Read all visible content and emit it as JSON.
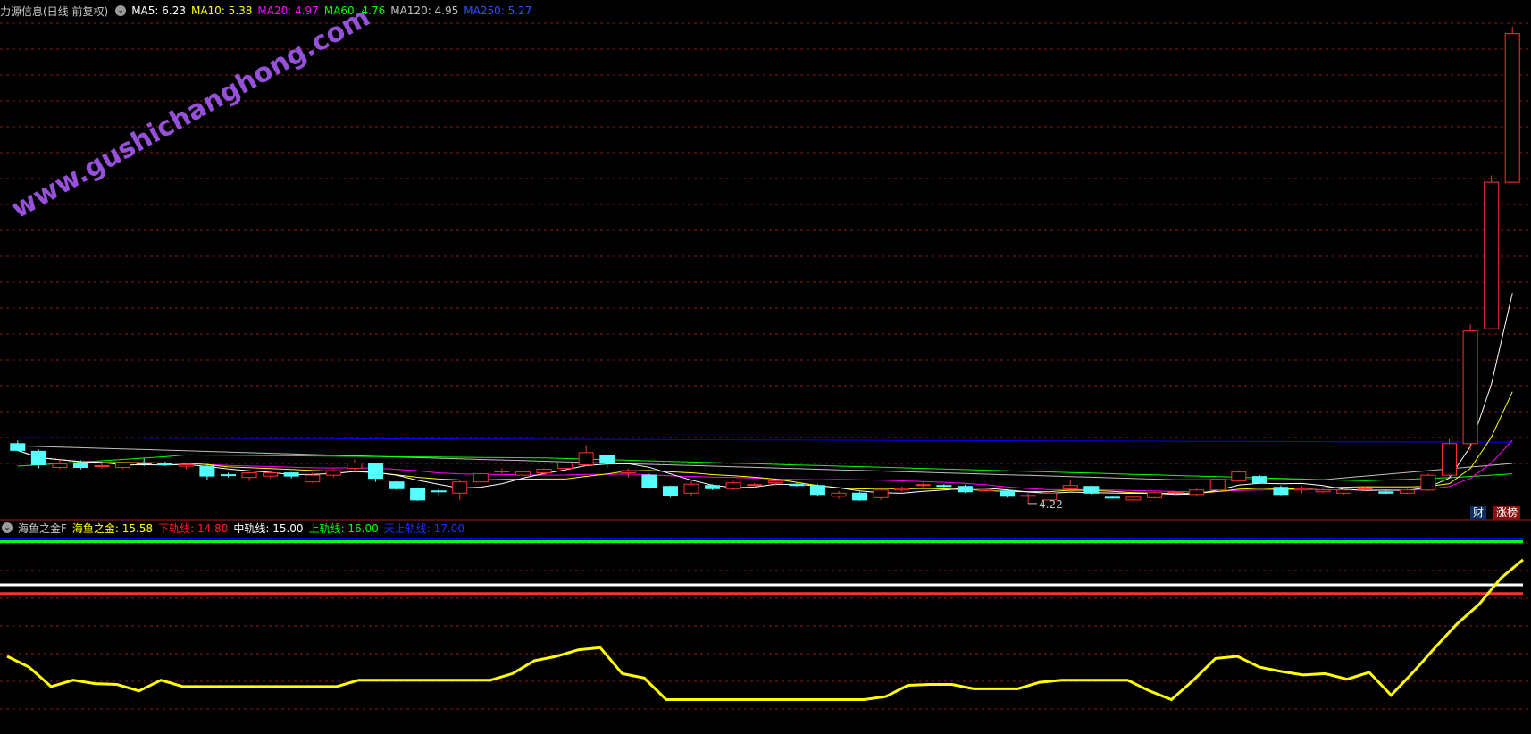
{
  "stock": {
    "title": "力源信息(日线 前复权)",
    "ma": [
      {
        "label": "MA5:",
        "value": "6.23",
        "color": "#ffffff"
      },
      {
        "label": "MA10:",
        "value": "5.38",
        "color": "#ffff00"
      },
      {
        "label": "MA20:",
        "value": "4.97",
        "color": "#ff00ff"
      },
      {
        "label": "MA60:",
        "value": "4.76",
        "color": "#00ff00"
      },
      {
        "label": "MA120:",
        "value": "4.95",
        "color": "#c0c0c0"
      },
      {
        "label": "MA250:",
        "value": "5.27",
        "color": "#3050ff"
      }
    ]
  },
  "watermark": "www.gushichanghong.com",
  "low_marker": "4.22",
  "tags": {
    "cai": "财",
    "zhang": "涨榜"
  },
  "indicator": {
    "name": "海鱼之金F",
    "items": [
      {
        "label": "海鱼之金:",
        "value": "15.58",
        "color": "#ffff00"
      },
      {
        "label": "下轨线:",
        "value": "14.80",
        "color": "#ff2020"
      },
      {
        "label": "中轨线:",
        "value": "15.00",
        "color": "#ffffff"
      },
      {
        "label": "上轨线:",
        "value": "16.00",
        "color": "#00ff00"
      },
      {
        "label": "天上轨线:",
        "value": "17.00",
        "color": "#2030ff"
      }
    ]
  },
  "colors": {
    "up": "#ff3030",
    "down": "#54ffff",
    "grid": "#8b1a1a",
    "frame": "#b02020",
    "ma5": "#ffffff",
    "ma10": "#ffff00",
    "ma20": "#ff00ff",
    "ma60": "#00ff00",
    "ma120": "#c0c0c0",
    "ma250": "#0000ff",
    "osc": "#ffff00",
    "watermark": "#b060ff"
  },
  "chart_data": [
    {
      "type": "candlestick",
      "title": "力源信息(日线 前复权)",
      "y_range": [
        4.0,
        15.0
      ],
      "grid": true,
      "low_label": "4.22",
      "candles": [
        {
          "o": 5.55,
          "h": 5.62,
          "l": 5.45,
          "c": 5.4
        },
        {
          "o": 5.38,
          "h": 5.42,
          "l": 5.0,
          "c": 5.08
        },
        {
          "o": 5.02,
          "h": 5.2,
          "l": 4.98,
          "c": 5.1
        },
        {
          "o": 5.1,
          "h": 5.18,
          "l": 4.98,
          "c": 5.02
        },
        {
          "o": 5.05,
          "h": 5.12,
          "l": 5.0,
          "c": 5.06
        },
        {
          "o": 5.02,
          "h": 5.15,
          "l": 4.98,
          "c": 5.12
        },
        {
          "o": 5.12,
          "h": 5.22,
          "l": 5.05,
          "c": 5.1
        },
        {
          "o": 5.12,
          "h": 5.15,
          "l": 5.05,
          "c": 5.08
        },
        {
          "o": 5.05,
          "h": 5.12,
          "l": 4.98,
          "c": 5.08
        },
        {
          "o": 5.05,
          "h": 5.1,
          "l": 4.75,
          "c": 4.83
        },
        {
          "o": 4.86,
          "h": 4.9,
          "l": 4.8,
          "c": 4.85
        },
        {
          "o": 4.8,
          "h": 4.92,
          "l": 4.72,
          "c": 4.9
        },
        {
          "o": 4.83,
          "h": 4.95,
          "l": 4.78,
          "c": 4.9
        },
        {
          "o": 4.9,
          "h": 4.92,
          "l": 4.78,
          "c": 4.83
        },
        {
          "o": 4.7,
          "h": 4.9,
          "l": 4.68,
          "c": 4.85
        },
        {
          "o": 4.85,
          "h": 4.98,
          "l": 4.8,
          "c": 4.95
        },
        {
          "o": 5.0,
          "h": 5.2,
          "l": 4.95,
          "c": 5.12
        },
        {
          "o": 5.1,
          "h": 5.12,
          "l": 4.7,
          "c": 4.78
        },
        {
          "o": 4.7,
          "h": 4.72,
          "l": 4.52,
          "c": 4.55
        },
        {
          "o": 4.55,
          "h": 4.58,
          "l": 4.28,
          "c": 4.3
        },
        {
          "o": 4.5,
          "h": 4.55,
          "l": 4.4,
          "c": 4.48
        },
        {
          "o": 4.45,
          "h": 4.75,
          "l": 4.3,
          "c": 4.7
        },
        {
          "o": 4.7,
          "h": 4.9,
          "l": 4.68,
          "c": 4.88
        },
        {
          "o": 4.92,
          "h": 5.0,
          "l": 4.88,
          "c": 4.94
        },
        {
          "o": 4.85,
          "h": 4.95,
          "l": 4.82,
          "c": 4.92
        },
        {
          "o": 4.9,
          "h": 5.0,
          "l": 4.85,
          "c": 4.98
        },
        {
          "o": 5.0,
          "h": 5.15,
          "l": 4.95,
          "c": 5.12
        },
        {
          "o": 5.08,
          "h": 5.52,
          "l": 5.05,
          "c": 5.35
        },
        {
          "o": 5.28,
          "h": 5.3,
          "l": 5.02,
          "c": 5.12
        },
        {
          "o": 4.9,
          "h": 5.0,
          "l": 4.8,
          "c": 4.95
        },
        {
          "o": 4.85,
          "h": 4.88,
          "l": 4.55,
          "c": 4.58
        },
        {
          "o": 4.6,
          "h": 4.62,
          "l": 4.35,
          "c": 4.4
        },
        {
          "o": 4.45,
          "h": 4.72,
          "l": 4.38,
          "c": 4.65
        },
        {
          "o": 4.62,
          "h": 4.65,
          "l": 4.52,
          "c": 4.55
        },
        {
          "o": 4.55,
          "h": 4.72,
          "l": 4.52,
          "c": 4.68
        },
        {
          "o": 4.62,
          "h": 4.68,
          "l": 4.58,
          "c": 4.64
        },
        {
          "o": 4.68,
          "h": 4.75,
          "l": 4.62,
          "c": 4.72
        },
        {
          "o": 4.65,
          "h": 4.68,
          "l": 4.6,
          "c": 4.62
        },
        {
          "o": 4.62,
          "h": 4.65,
          "l": 4.38,
          "c": 4.42
        },
        {
          "o": 4.38,
          "h": 4.5,
          "l": 4.32,
          "c": 4.45
        },
        {
          "o": 4.45,
          "h": 4.48,
          "l": 4.28,
          "c": 4.3
        },
        {
          "o": 4.35,
          "h": 4.55,
          "l": 4.3,
          "c": 4.52
        },
        {
          "o": 4.52,
          "h": 4.6,
          "l": 4.48,
          "c": 4.55
        },
        {
          "o": 4.62,
          "h": 4.68,
          "l": 4.58,
          "c": 4.64
        },
        {
          "o": 4.62,
          "h": 4.65,
          "l": 4.58,
          "c": 4.6
        },
        {
          "o": 4.6,
          "h": 4.64,
          "l": 4.45,
          "c": 4.48
        },
        {
          "o": 4.52,
          "h": 4.56,
          "l": 4.48,
          "c": 4.52
        },
        {
          "o": 4.5,
          "h": 4.52,
          "l": 4.35,
          "c": 4.38
        },
        {
          "o": 4.4,
          "h": 4.45,
          "l": 4.22,
          "c": 4.4
        },
        {
          "o": 4.3,
          "h": 4.48,
          "l": 4.28,
          "c": 4.45
        },
        {
          "o": 4.55,
          "h": 4.75,
          "l": 4.52,
          "c": 4.62
        },
        {
          "o": 4.6,
          "h": 4.62,
          "l": 4.42,
          "c": 4.45
        },
        {
          "o": 4.36,
          "h": 4.38,
          "l": 4.33,
          "c": 4.35
        },
        {
          "o": 4.3,
          "h": 4.4,
          "l": 4.28,
          "c": 4.36
        },
        {
          "o": 4.35,
          "h": 4.48,
          "l": 4.33,
          "c": 4.46
        },
        {
          "o": 4.46,
          "h": 4.5,
          "l": 4.42,
          "c": 4.48
        },
        {
          "o": 4.42,
          "h": 4.55,
          "l": 4.4,
          "c": 4.52
        },
        {
          "o": 4.52,
          "h": 4.78,
          "l": 4.5,
          "c": 4.76
        },
        {
          "o": 4.72,
          "h": 4.96,
          "l": 4.7,
          "c": 4.92
        },
        {
          "o": 4.82,
          "h": 4.85,
          "l": 4.66,
          "c": 4.68
        },
        {
          "o": 4.58,
          "h": 4.62,
          "l": 4.4,
          "c": 4.42
        },
        {
          "o": 4.52,
          "h": 4.6,
          "l": 4.45,
          "c": 4.55
        },
        {
          "o": 4.48,
          "h": 4.55,
          "l": 4.45,
          "c": 4.52
        },
        {
          "o": 4.45,
          "h": 4.54,
          "l": 4.42,
          "c": 4.52
        },
        {
          "o": 4.54,
          "h": 4.6,
          "l": 4.5,
          "c": 4.55
        },
        {
          "o": 4.48,
          "h": 4.5,
          "l": 4.43,
          "c": 4.45
        },
        {
          "o": 4.45,
          "h": 4.55,
          "l": 4.43,
          "c": 4.52
        },
        {
          "o": 4.52,
          "h": 4.88,
          "l": 4.5,
          "c": 4.85
        },
        {
          "o": 4.85,
          "h": 5.65,
          "l": 4.82,
          "c": 5.55
        },
        {
          "o": 5.55,
          "h": 8.2,
          "l": 5.4,
          "c": 8.05
        },
        {
          "o": 8.1,
          "h": 11.5,
          "l": 9.8,
          "c": 11.35
        },
        {
          "o": 11.35,
          "h": 14.8,
          "l": 11.35,
          "c": 14.65
        }
      ],
      "moving_averages": [
        {
          "name": "MA5",
          "value": 6.23
        },
        {
          "name": "MA10",
          "value": 5.38
        },
        {
          "name": "MA20",
          "value": 4.97
        },
        {
          "name": "MA60",
          "value": 4.76
        },
        {
          "name": "MA120",
          "value": 4.95
        },
        {
          "name": "MA250",
          "value": 5.27
        }
      ]
    },
    {
      "type": "line",
      "title": "海鱼之金F",
      "y_range": [
        11.7,
        16.3
      ],
      "levels": [
        {
          "name": "天上轨线",
          "value": 17.0
        },
        {
          "name": "上轨线",
          "value": 16.0
        },
        {
          "name": "中轨线",
          "value": 15.0
        },
        {
          "name": "下轨线",
          "value": 14.8
        }
      ],
      "series": [
        {
          "name": "海鱼之金",
          "values": [
            13.35,
            13.1,
            12.65,
            12.8,
            12.72,
            12.7,
            12.55,
            12.8,
            12.65,
            12.65,
            12.65,
            12.65,
            12.65,
            12.65,
            12.65,
            12.65,
            12.8,
            12.8,
            12.8,
            12.8,
            12.8,
            12.8,
            12.8,
            12.95,
            13.25,
            13.35,
            13.5,
            13.55,
            12.95,
            12.85,
            12.35,
            12.35,
            12.35,
            12.35,
            12.35,
            12.35,
            12.35,
            12.35,
            12.35,
            12.35,
            12.42,
            12.68,
            12.7,
            12.7,
            12.6,
            12.6,
            12.6,
            12.75,
            12.8,
            12.8,
            12.8,
            12.8,
            12.55,
            12.35,
            12.8,
            13.3,
            13.35,
            13.1,
            13.0,
            12.92,
            12.95,
            12.82,
            12.98,
            12.45,
            12.98,
            13.55,
            14.1,
            14.55,
            15.16,
            15.58
          ]
        }
      ]
    }
  ]
}
